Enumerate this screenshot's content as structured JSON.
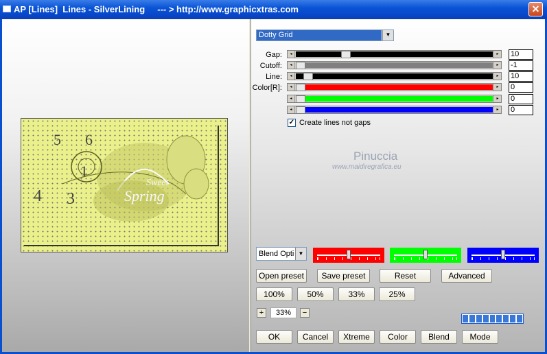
{
  "window": {
    "title": "AP [Lines]  Lines - SilverLining     --- > http://www.graphicxtras.com",
    "close_label": "✕"
  },
  "preview": {
    "numbers": [
      "5",
      "6",
      "1",
      "4",
      "3"
    ],
    "script_text": "Sweet",
    "script_text2": "Spring"
  },
  "effect_select": {
    "value": "Dotty Grid"
  },
  "params": [
    {
      "label": "Gap:",
      "value": "10",
      "fill": "#000000",
      "position": 0.24
    },
    {
      "label": "Cutoff:",
      "value": "-1",
      "fill": "#808080",
      "position": 0.0
    },
    {
      "label": "Line:",
      "value": "10",
      "fill": "#000000",
      "position": 0.04
    },
    {
      "label": "Color[R]:",
      "value": "0",
      "fill": "#ff0000",
      "position": 0.0
    },
    {
      "label": "",
      "value": "0",
      "fill": "#00ff00",
      "position": 0.0
    },
    {
      "label": "",
      "value": "0",
      "fill": "#0000ff",
      "position": 0.0
    }
  ],
  "create_lines": {
    "label": "Create lines not gaps",
    "checked": true
  },
  "watermark": {
    "name": "Pinuccia",
    "site": "www.maidiregrafica.eu"
  },
  "blend_select": {
    "value": "Blend Optio"
  },
  "rgb_sliders": [
    {
      "name": "red",
      "color": "#ff0000",
      "position": 0.5
    },
    {
      "name": "green",
      "color": "#00ff00",
      "position": 0.5
    },
    {
      "name": "blue",
      "color": "#0000ff",
      "position": 0.5
    }
  ],
  "preset_buttons": [
    "Open preset",
    "Save preset",
    "Reset",
    "Advanced"
  ],
  "zoom_buttons": [
    "100%",
    "50%",
    "33%",
    "25%"
  ],
  "zoom": {
    "minus": "+",
    "value": "33%",
    "plus": "−"
  },
  "progress": {
    "segments": 9
  },
  "bottom_buttons": [
    "OK",
    "Cancel",
    "Xtreme",
    "Color",
    "Blend",
    "Mode"
  ],
  "colors": {
    "title_bar": "#0a54d6",
    "preview_bg": "#eaf08a"
  }
}
